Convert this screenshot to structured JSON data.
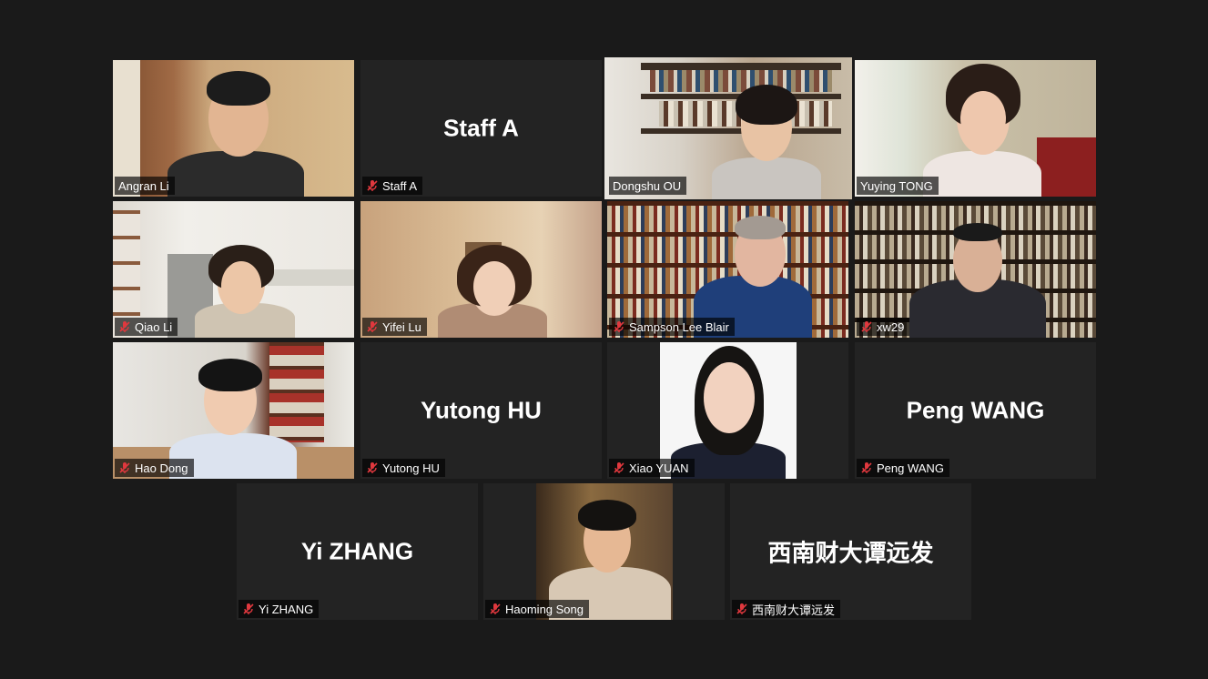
{
  "participants": [
    {
      "name": "Angran Li",
      "video": true,
      "muted": false
    },
    {
      "name": "Staff A",
      "video": false,
      "muted": true
    },
    {
      "name": "Dongshu OU",
      "video": true,
      "muted": false,
      "speaking": true
    },
    {
      "name": "Yuying TONG",
      "video": true,
      "muted": false
    },
    {
      "name": "Qiao Li",
      "video": true,
      "muted": true
    },
    {
      "name": "Yifei Lu",
      "video": true,
      "muted": true
    },
    {
      "name": "Sampson Lee Blair",
      "video": true,
      "muted": true
    },
    {
      "name": "xw29",
      "video": true,
      "muted": true
    },
    {
      "name": "Hao Dong",
      "video": true,
      "muted": true
    },
    {
      "name": "Yutong HU",
      "video": false,
      "muted": true
    },
    {
      "name": "Xiao YUAN",
      "video": true,
      "muted": true
    },
    {
      "name": "Peng WANG",
      "video": false,
      "muted": true
    },
    {
      "name": "Yi ZHANG",
      "video": false,
      "muted": true
    },
    {
      "name": "Haoming Song",
      "video": true,
      "muted": true
    },
    {
      "name": "西南财大谭远发",
      "video": false,
      "muted": true
    }
  ],
  "colors": {
    "background": "#1a1a1a",
    "tile": "#232323",
    "speaking_border": "#b6e04a",
    "muted_icon": "#e0383e"
  }
}
